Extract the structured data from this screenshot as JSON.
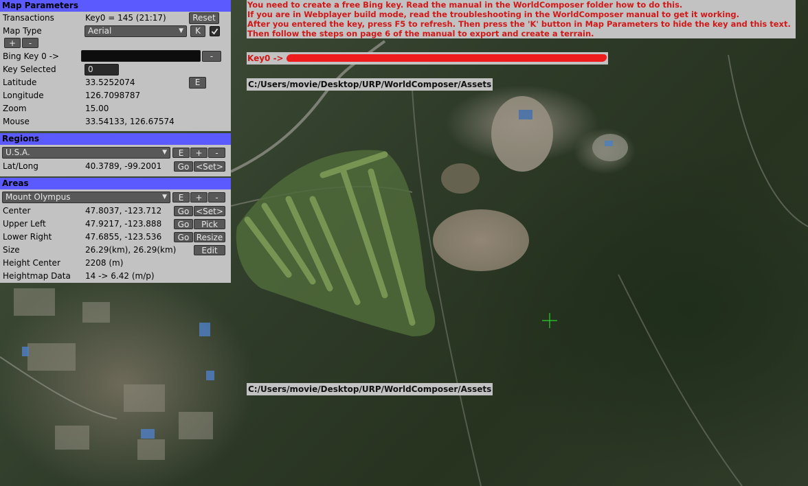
{
  "map_parameters": {
    "header": "Map Parameters",
    "transactions_label": "Transactions",
    "transactions_value": "Key0 = 145 (21:17)",
    "reset_label": "Reset",
    "map_type_label": "Map Type",
    "map_type_value": "Aerial",
    "k_label": "K",
    "k_checked": true,
    "plus_label": "+",
    "minus_label": "-",
    "bing_key_label": "Bing Key 0 ->",
    "bing_key_minus_label": "-",
    "key_selected_label": "Key Selected",
    "key_selected_value": "0",
    "latitude_label": "Latitude",
    "latitude_value": "33.5252074",
    "e_label": "E",
    "longitude_label": "Longitude",
    "longitude_value": "126.7098787",
    "zoom_label": "Zoom",
    "zoom_value": "15.00",
    "mouse_label": "Mouse",
    "mouse_value": "33.54133, 126.67574"
  },
  "regions": {
    "header": "Regions",
    "selected": "U.S.A.",
    "e_label": "E",
    "plus_label": "+",
    "minus_label": "-",
    "latlong_label": "Lat/Long",
    "latlong_value": "40.3789, -99.2001",
    "go_label": "Go",
    "set_label": "<Set>"
  },
  "areas": {
    "header": "Areas",
    "selected": "Mount Olympus",
    "e_label": "E",
    "plus_label": "+",
    "minus_label": "-",
    "center_label": "Center",
    "center_value": "47.8037, -123.712",
    "center_go": "Go",
    "center_set": "<Set>",
    "upper_left_label": "Upper Left",
    "upper_left_value": "47.9217, -123.888",
    "upper_left_go": "Go",
    "pick_label": "Pick",
    "lower_right_label": "Lower Right",
    "lower_right_value": "47.6855, -123.536",
    "lower_right_go": "Go",
    "resize_label": "Resize",
    "size_label": "Size",
    "size_value": "26.29(km), 26.29(km)",
    "edit_label": "Edit",
    "height_center_label": "Height Center",
    "height_center_value": "2208 (m)",
    "heightmap_label": "Heightmap Data",
    "heightmap_value": "14 -> 6.42 (m/p)"
  },
  "warning": {
    "line1": "You need to create a free Bing key. Read the manual in the WorldComposer folder how to do this.",
    "line2": "If you are in Webplayer build mode, read the troubleshooting in the WorldComposer manual to get it working.",
    "line3": "After you entered the key, press F5 to refresh. Then press the 'K' button in Map Parameters to hide the key and this text.",
    "line4": "Then follow the steps on page 6 of the manual to export and create a terrain."
  },
  "key_overlay": {
    "label": "Key0 ->"
  },
  "paths": {
    "top": "C:/Users/movie/Desktop/URP/WorldComposer/Assets",
    "bottom": "C:/Users/movie/Desktop/URP/WorldComposer/Assets"
  },
  "colors": {
    "panel_bg": "#c2c2c2",
    "header_bg": "#5a5aff",
    "button_bg": "#585858",
    "warning_text": "#d01818",
    "crosshair": "#2bd22b"
  }
}
